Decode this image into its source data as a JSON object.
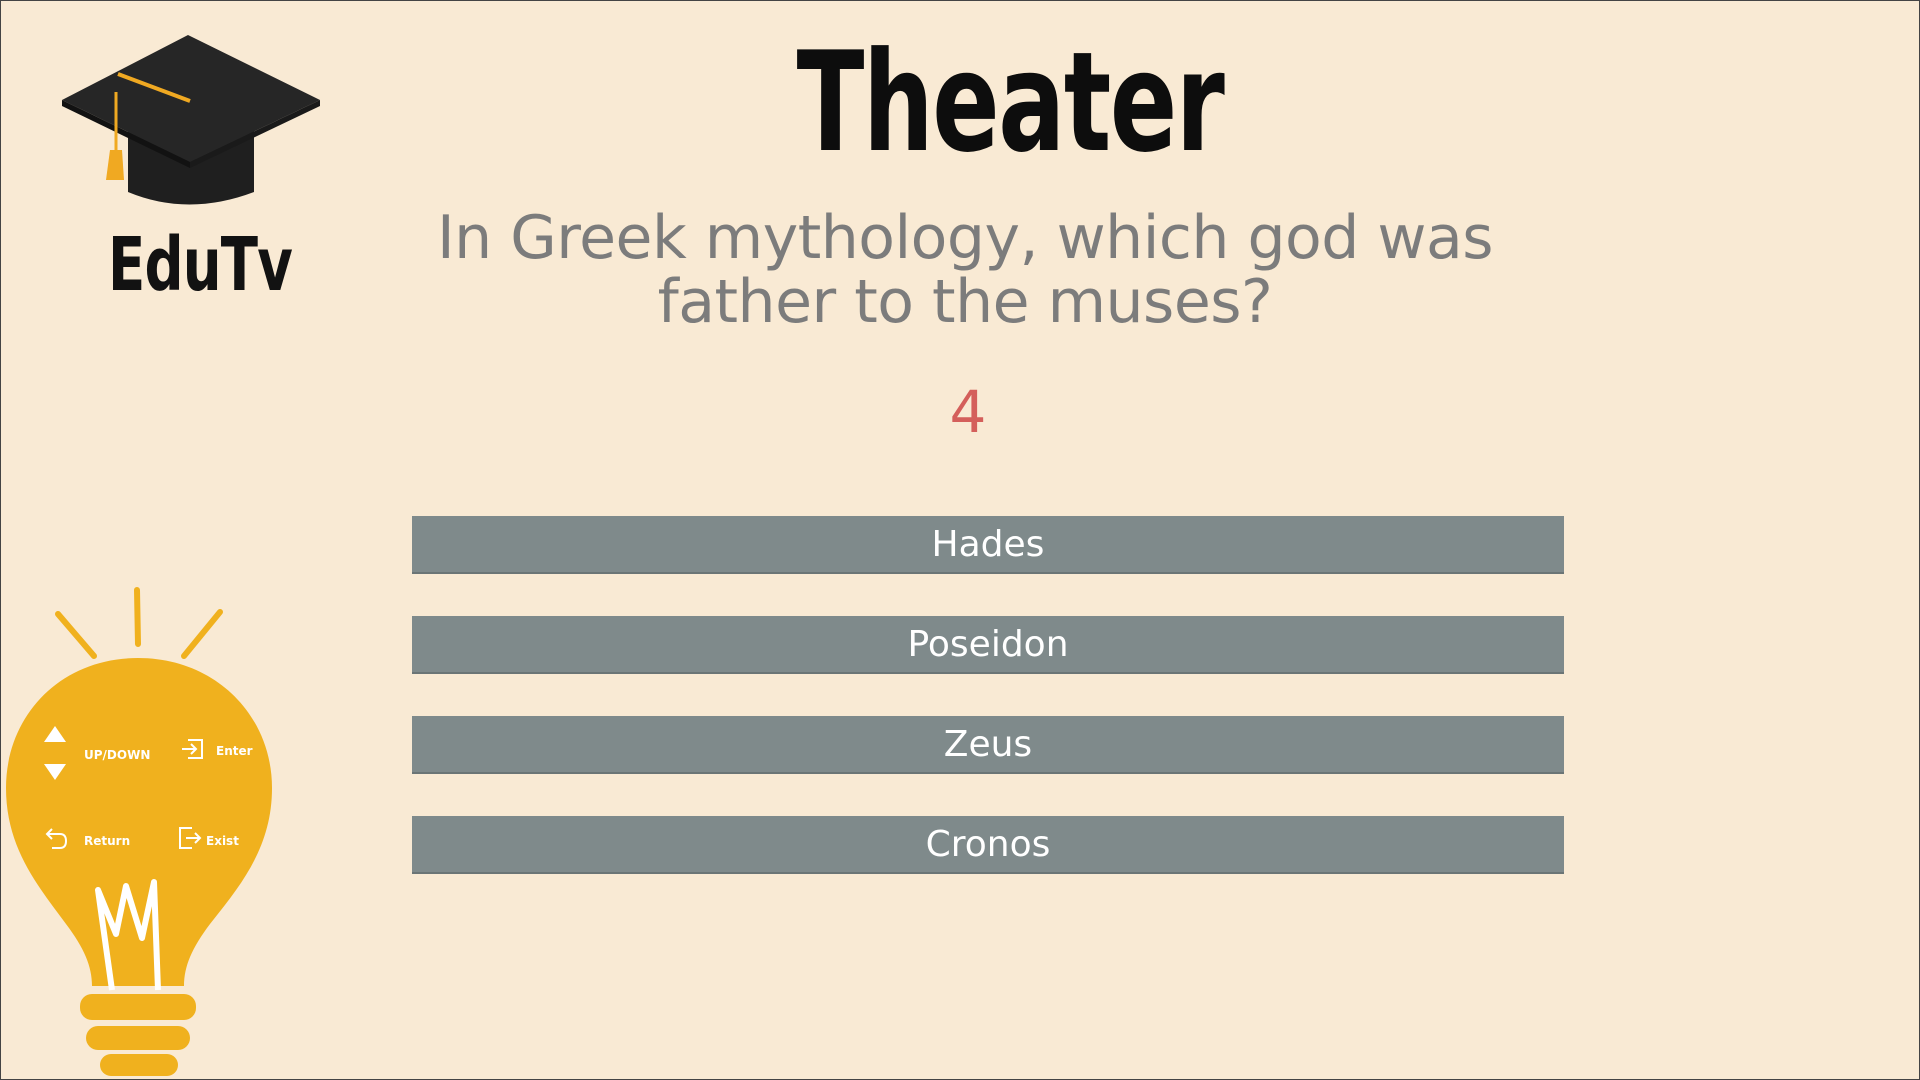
{
  "brand": {
    "name": "EduTv",
    "cap_icon": "graduation-cap-icon",
    "colors": {
      "cap": "#1f1f1f",
      "tassel": "#f0a922"
    }
  },
  "quiz": {
    "category": "Theater",
    "question": "In Greek mythology, which god was father to the muses?",
    "timer": "4",
    "answers": [
      "Hades",
      "Poseidon",
      "Zeus",
      "Cronos"
    ]
  },
  "controls": {
    "up_down": "UP/DOWN",
    "enter": "Enter",
    "return": "Return",
    "exist": "Exist"
  },
  "colors": {
    "background": "#f9ead4",
    "answer_bg": "#7f8a8b",
    "timer": "#d45f5b",
    "bulb": "#f0b11e"
  }
}
